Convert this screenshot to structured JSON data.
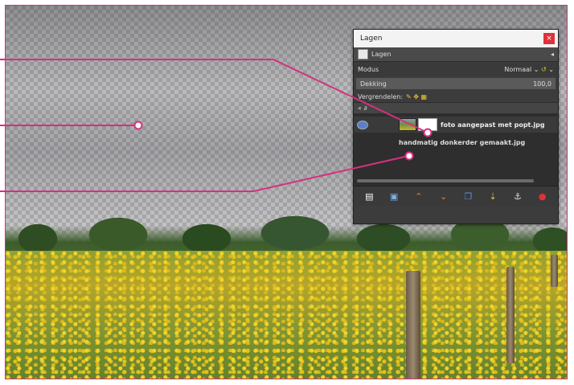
{
  "dialog": {
    "title": "Lagen",
    "close_label": "×",
    "tab_label": "Lagen",
    "tab_arrow": "◂",
    "mode_label": "Modus",
    "mode_value": "Normaal",
    "opacity_label": "Dekking",
    "opacity_value": "100,0",
    "lock_label": "Vergrendelen:",
    "lock_icons": "✎ ✥ ▦",
    "filter_label": "«  ∂",
    "layers": [
      {
        "name": "foto aangepast met popt.jpg",
        "visible": true,
        "selected": true
      },
      {
        "name": "handmatig donkerder gemaakt.jpg",
        "visible": false,
        "selected": false
      }
    ],
    "toolbar": [
      {
        "name": "new-layer-icon",
        "glyph": "▤",
        "color": "#ffffff"
      },
      {
        "name": "new-layer-group-icon",
        "glyph": "▣",
        "color": "#7fb0e8"
      },
      {
        "name": "raise-layer-icon",
        "glyph": "⌃",
        "color": "#e8843c"
      },
      {
        "name": "lower-layer-icon",
        "glyph": "⌄",
        "color": "#e8843c"
      },
      {
        "name": "duplicate-layer-icon",
        "glyph": "❐",
        "color": "#5b8ee0"
      },
      {
        "name": "merge-down-icon",
        "glyph": "⇣",
        "color": "#e7c43c"
      },
      {
        "name": "anchor-layer-icon",
        "glyph": "⚓",
        "color": "#e0e0e0"
      },
      {
        "name": "delete-layer-icon",
        "glyph": "●",
        "color": "#e0303a"
      }
    ]
  },
  "colors": {
    "callout": "#d6307e",
    "frame": "#d6307e",
    "dialog_bg": "#3c3c3c"
  }
}
